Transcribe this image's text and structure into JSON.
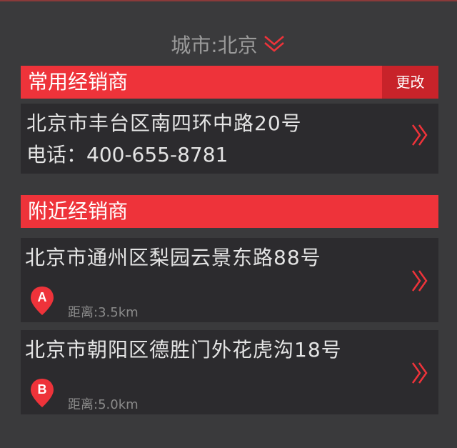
{
  "city": {
    "label": "城市:北京",
    "icon": "double-chevron-down-icon"
  },
  "favorite_dealer": {
    "header": "常用经销商",
    "change_label": "更改",
    "address": "北京市丰台区南四环中路20号",
    "phone": "电话：400-655-8781"
  },
  "nearby_dealers": {
    "header": "附近经销商",
    "items": [
      {
        "marker": "A",
        "address": "北京市通州区梨园云景东路88号",
        "distance": "距离:3.5km"
      },
      {
        "marker": "B",
        "address": "北京市朝阳区德胜门外花虎沟18号",
        "distance": "距离:5.0km"
      }
    ]
  },
  "colors": {
    "accent": "#ee333a",
    "accent_dark": "#c8232a",
    "background": "#3a3a3c",
    "card": "#2c2b2e"
  }
}
